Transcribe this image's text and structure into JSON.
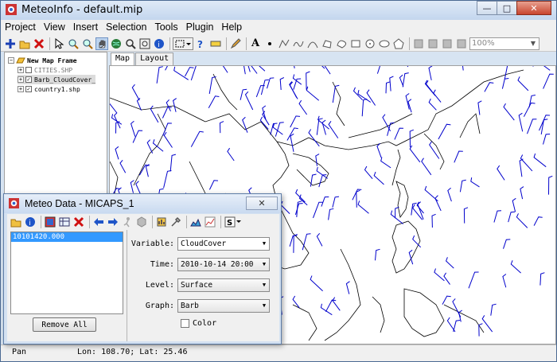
{
  "window": {
    "title": "MeteoInfo - default.mip",
    "minimize": "—",
    "maximize": "□",
    "close": "✕"
  },
  "menubar": [
    "Project",
    "View",
    "Insert",
    "Selection",
    "Tools",
    "Plugin",
    "Help"
  ],
  "toolbar": {
    "zoom_value": "100%"
  },
  "legend": {
    "frame_title": "New Map Frame",
    "layers": [
      {
        "name": "CITIES.SHP",
        "checked": false
      },
      {
        "name": "Barb_CloudCover_",
        "checked": true
      },
      {
        "name": "country1.shp",
        "checked": true
      }
    ]
  },
  "tabs": [
    "Map",
    "Layout"
  ],
  "statusbar": {
    "mode": "Pan",
    "coords": "Lon: 108.70; Lat: 25.46"
  },
  "dialog": {
    "title": "Meteo Data - MICAPS_1",
    "close": "✕",
    "times": [
      "10101420.000"
    ],
    "remove_all": "Remove All",
    "variable_label": "Variable:",
    "variable_value": "CloudCover",
    "time_label": "Time:",
    "time_value": "2010-10-14 20:00",
    "level_label": "Level:",
    "level_value": "Surface",
    "graph_label": "Graph:",
    "graph_value": "Barb",
    "color_label": "Color",
    "color_checked": false
  },
  "colors": {
    "barb": "#0000cc",
    "coast": "#000000",
    "selection": "#3399ff"
  }
}
